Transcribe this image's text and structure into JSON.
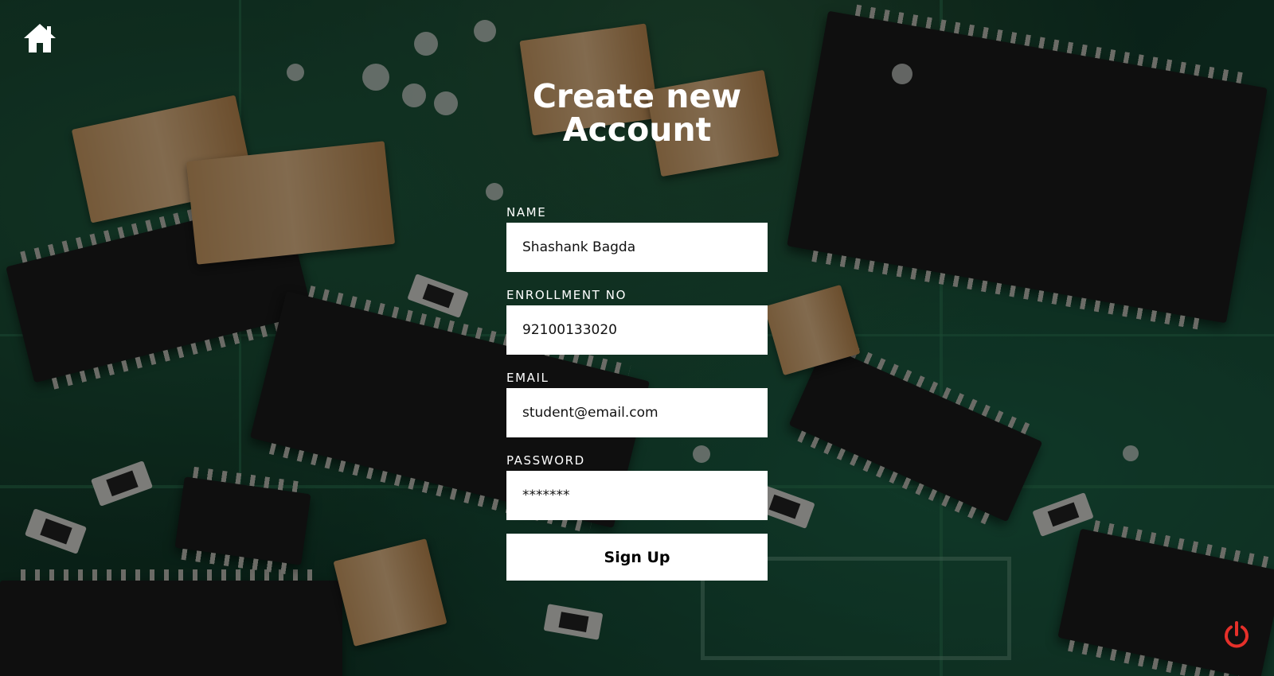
{
  "page": {
    "title_line1": "Create new",
    "title_line2": "Account"
  },
  "icons": {
    "home": "home-icon",
    "power": "power-icon",
    "power_color": "#e5302a"
  },
  "form": {
    "name": {
      "label": "NAME",
      "value": "Shashank Bagda"
    },
    "enrollment": {
      "label": "ENROLLMENT NO",
      "value": "92100133020"
    },
    "email": {
      "label": "EMAIL",
      "value": "student@email.com"
    },
    "password": {
      "label": "PASSWORD",
      "value": "*******"
    },
    "submit_label": "Sign Up"
  },
  "background": {
    "description_color": "#0f3526"
  }
}
